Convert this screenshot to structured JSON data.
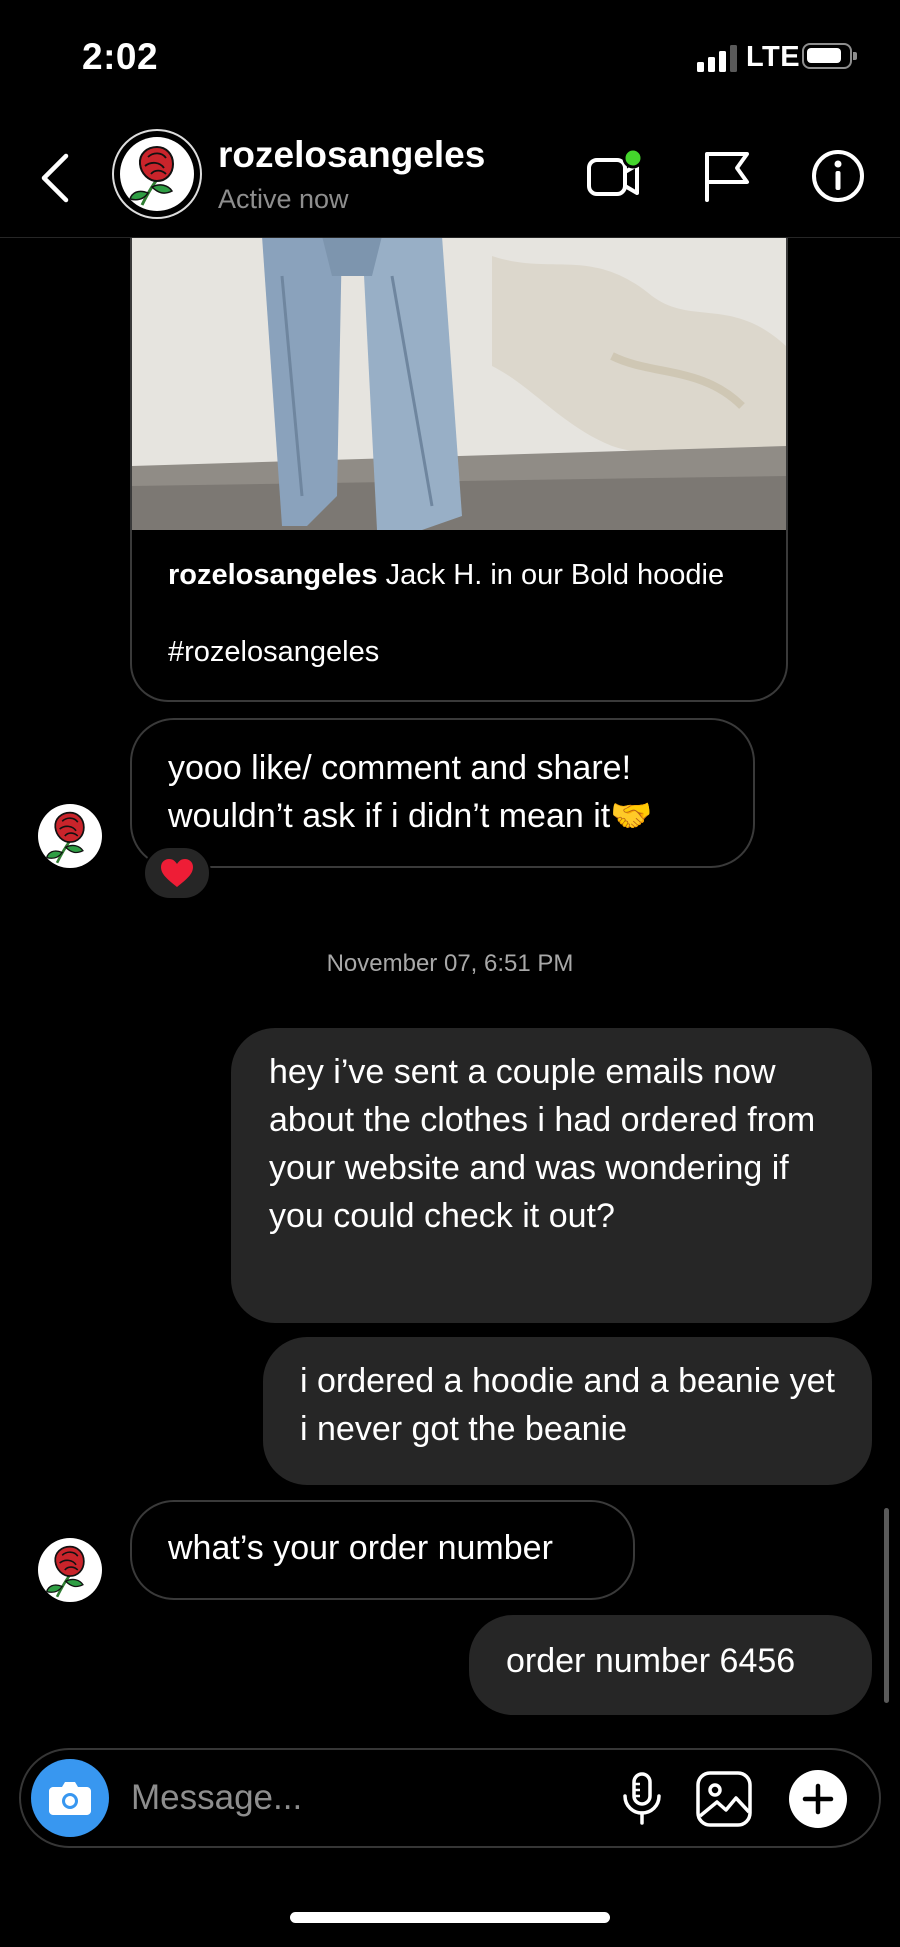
{
  "status_bar": {
    "time": "2:02",
    "network": "LTE"
  },
  "header": {
    "username": "rozelosangeles",
    "activity": "Active now"
  },
  "post": {
    "author": "rozelosangeles",
    "caption": " Jack H. in our Bold hoodie",
    "hashtag": "#rozelosangeles"
  },
  "messages": [
    {
      "sender": "them",
      "text": "yooo like/ comment and share! wouldn’t ask if i didn’t mean it🤝",
      "reaction": "❤️"
    },
    {
      "sender": "me",
      "text": "hey i’ve sent a couple emails now about the clothes i had ordered from your website and was wondering if you could check it out?"
    },
    {
      "sender": "me",
      "text": "i ordered a hoodie and a beanie yet i never got the beanie"
    },
    {
      "sender": "them",
      "text": "what’s your order number"
    },
    {
      "sender": "me",
      "text": "order number 6456"
    }
  ],
  "divider_timestamp": "November 07, 6:51 PM",
  "composer": {
    "placeholder": "Message..."
  },
  "icons": {
    "header": [
      "chevron-left-icon",
      "video-call-icon",
      "flag-icon",
      "info-icon"
    ],
    "composer": [
      "camera-icon",
      "microphone-icon",
      "gallery-icon",
      "plus-icon"
    ]
  },
  "colors": {
    "background": "#000000",
    "outgoing_bubble": "#262626",
    "incoming_border": "#3a3a3a",
    "camera_button": "#3897f0",
    "active_dot": "#44d62c",
    "secondary_text": "#8e8e8e"
  }
}
